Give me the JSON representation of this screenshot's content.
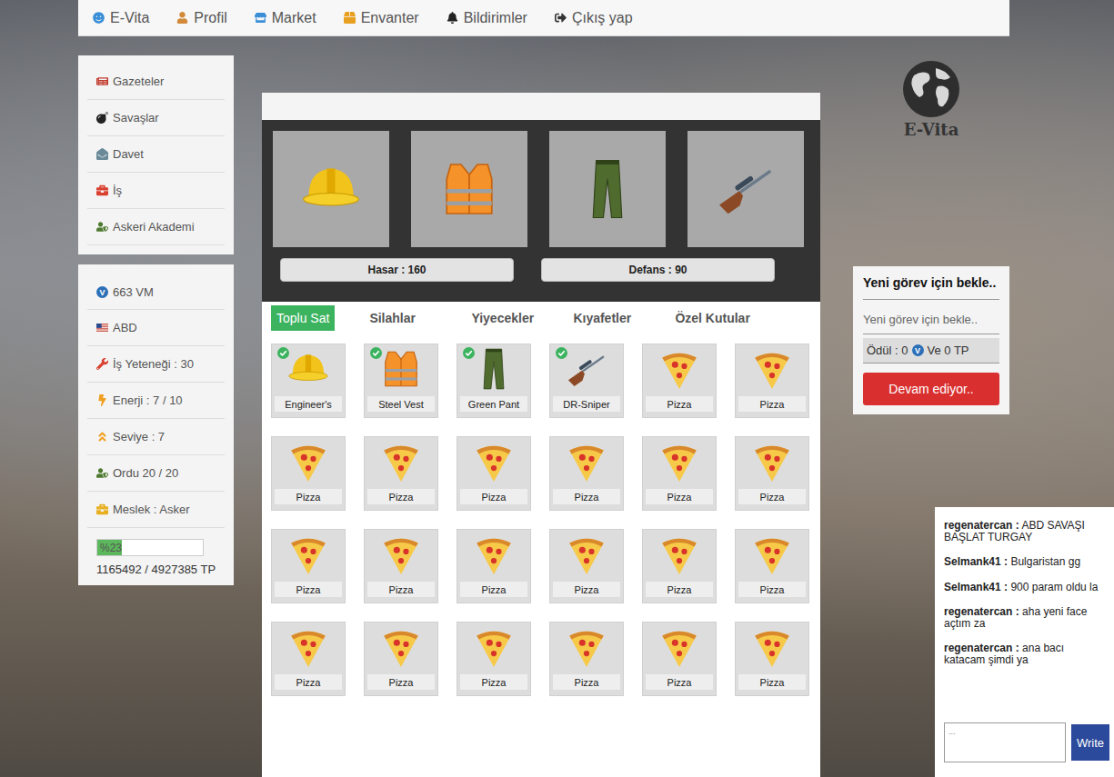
{
  "nav": [
    {
      "label": "E-Vita",
      "kind": "home"
    },
    {
      "label": "Profil",
      "kind": "profile"
    },
    {
      "label": "Market",
      "kind": "market"
    },
    {
      "label": "Envanter",
      "kind": "inventory"
    },
    {
      "label": "Bildirimler",
      "kind": "notifications"
    },
    {
      "label": "Çıkış yap",
      "kind": "logout"
    }
  ],
  "sidebar": {
    "menu": [
      {
        "label": "Gazeteler",
        "kind": "newspapers"
      },
      {
        "label": "Savaşlar",
        "kind": "wars"
      },
      {
        "label": "Davet",
        "kind": "invite"
      },
      {
        "label": "İş",
        "kind": "job"
      },
      {
        "label": "Askeri Akademi",
        "kind": "academy"
      }
    ],
    "stats": [
      {
        "label": "663 VM",
        "kind": "vm",
        "icon_text": "V"
      },
      {
        "label": "ABD",
        "kind": "flag"
      },
      {
        "label": "İş Yeteneği : 30",
        "kind": "skill"
      },
      {
        "label": "Enerji : 7 / 10",
        "kind": "energy"
      },
      {
        "label": "Seviye : 7",
        "kind": "level"
      },
      {
        "label": "Ordu 20 / 20",
        "kind": "army"
      },
      {
        "label": "Meslek : Asker",
        "kind": "profession"
      }
    ],
    "progress": {
      "label": "%23",
      "level": 0.23,
      "reading": "1165492 / 4927385 TP"
    }
  },
  "equipment": {
    "slots": [
      {
        "kind": "helmet"
      },
      {
        "kind": "vest"
      },
      {
        "kind": "pants"
      },
      {
        "kind": "sniper"
      }
    ],
    "stats": [
      "Hasar : 160",
      "Defans : 90"
    ]
  },
  "tabs": [
    {
      "label": "Toplu Sat",
      "selected": true
    },
    {
      "label": "Silahlar",
      "selected": false
    },
    {
      "label": "Yiyecekler",
      "selected": false
    },
    {
      "label": "Kıyafetler",
      "selected": false
    },
    {
      "label": "Özel Kutular",
      "selected": false
    }
  ],
  "inventory": [
    {
      "name": "Engineer's",
      "kind": "helmet",
      "equipped": true
    },
    {
      "name": "Steel Vest",
      "kind": "vest",
      "equipped": true
    },
    {
      "name": "Green Pant",
      "kind": "pants",
      "equipped": true
    },
    {
      "name": "DR-Sniper",
      "kind": "sniper",
      "equipped": true
    },
    {
      "name": "Pizza",
      "kind": "pizza",
      "equipped": false
    },
    {
      "name": "Pizza",
      "kind": "pizza",
      "equipped": false
    },
    {
      "name": "Pizza",
      "kind": "pizza",
      "equipped": false
    },
    {
      "name": "Pizza",
      "kind": "pizza",
      "equipped": false
    },
    {
      "name": "Pizza",
      "kind": "pizza",
      "equipped": false
    },
    {
      "name": "Pizza",
      "kind": "pizza",
      "equipped": false
    },
    {
      "name": "Pizza",
      "kind": "pizza",
      "equipped": false
    },
    {
      "name": "Pizza",
      "kind": "pizza",
      "equipped": false
    },
    {
      "name": "Pizza",
      "kind": "pizza",
      "equipped": false
    },
    {
      "name": "Pizza",
      "kind": "pizza",
      "equipped": false
    },
    {
      "name": "Pizza",
      "kind": "pizza",
      "equipped": false
    },
    {
      "name": "Pizza",
      "kind": "pizza",
      "equipped": false
    },
    {
      "name": "Pizza",
      "kind": "pizza",
      "equipped": false
    },
    {
      "name": "Pizza",
      "kind": "pizza",
      "equipped": false
    },
    {
      "name": "Pizza",
      "kind": "pizza",
      "equipped": false
    },
    {
      "name": "Pizza",
      "kind": "pizza",
      "equipped": false
    },
    {
      "name": "Pizza",
      "kind": "pizza",
      "equipped": false
    },
    {
      "name": "Pizza",
      "kind": "pizza",
      "equipped": false
    },
    {
      "name": "Pizza",
      "kind": "pizza",
      "equipped": false
    },
    {
      "name": "Pizza",
      "kind": "pizza",
      "equipped": false
    }
  ],
  "logo": {
    "text": "E-Vita"
  },
  "task": {
    "title": "Yeni görev için bekle..",
    "description": "Yeni görev için bekle..",
    "reward_prefix": "Ödül : 0",
    "currency_icon": "V",
    "reward_suffix": "Ve 0 TP",
    "button": "Devam ediyor.."
  },
  "chat": {
    "messages": [
      {
        "user": "regenatercan :",
        "text": "ABD SAVAŞI BAŞLAT TURGAY"
      },
      {
        "user": "Selmank41 :",
        "text": "Bulgaristan gg"
      },
      {
        "user": "Selmank41 :",
        "text": "900 param oldu la"
      },
      {
        "user": "regenatercan :",
        "text": "aha yeni face açtım za"
      },
      {
        "user": "regenatercan :",
        "text": "ana bacı katacam şimdi ya"
      }
    ],
    "placeholder": "...",
    "button": "Write"
  }
}
